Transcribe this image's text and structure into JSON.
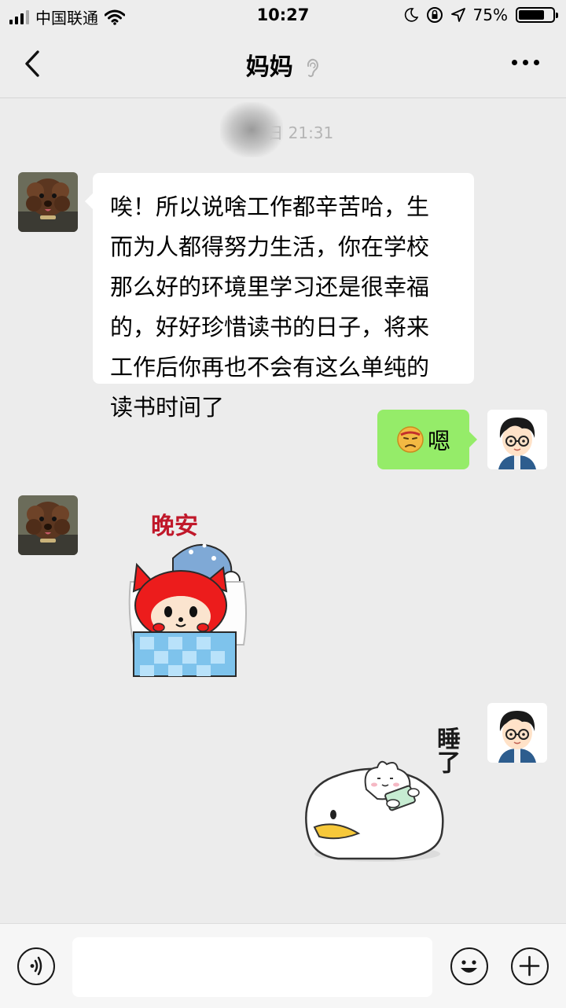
{
  "status_bar": {
    "carrier": "中国联通",
    "time": "10:27",
    "battery_text": "75%",
    "battery_level": 0.75,
    "icons": [
      "signal-icon",
      "wifi-icon",
      "moon-icon",
      "orientation-lock-icon",
      "location-icon",
      "battery-icon"
    ]
  },
  "header": {
    "title": "妈妈",
    "back_icon": "chevron-left-icon",
    "ear_icon": "ear-icon",
    "more_icon": "more-dots-icon"
  },
  "timestamp": "201      日 21:31",
  "messages": [
    {
      "side": "left",
      "type": "text",
      "lines": [
        "唉！所以说啥工作都辛苦哈，生",
        "而为人都得努力生活，你在学校",
        "那么好的环境里学习还是很幸福",
        "的，好好珍惜读书的日子，将来",
        "工作后你再也不会有这么单纯的",
        "读书时间了"
      ]
    },
    {
      "side": "right",
      "type": "text",
      "emoji": "frowning-face-icon",
      "text": "嗯"
    },
    {
      "side": "left",
      "type": "sticker",
      "sticker_text": "晚安"
    },
    {
      "side": "right",
      "type": "sticker",
      "sticker_text": "睡了"
    }
  ],
  "input_bar": {
    "voice_icon": "voice-icon",
    "emoji_icon": "emoji-icon",
    "plus_icon": "plus-icon",
    "input_value": ""
  },
  "colors": {
    "background": "#ececec",
    "sent_bubble": "#95ec69",
    "received_bubble": "#ffffff"
  }
}
